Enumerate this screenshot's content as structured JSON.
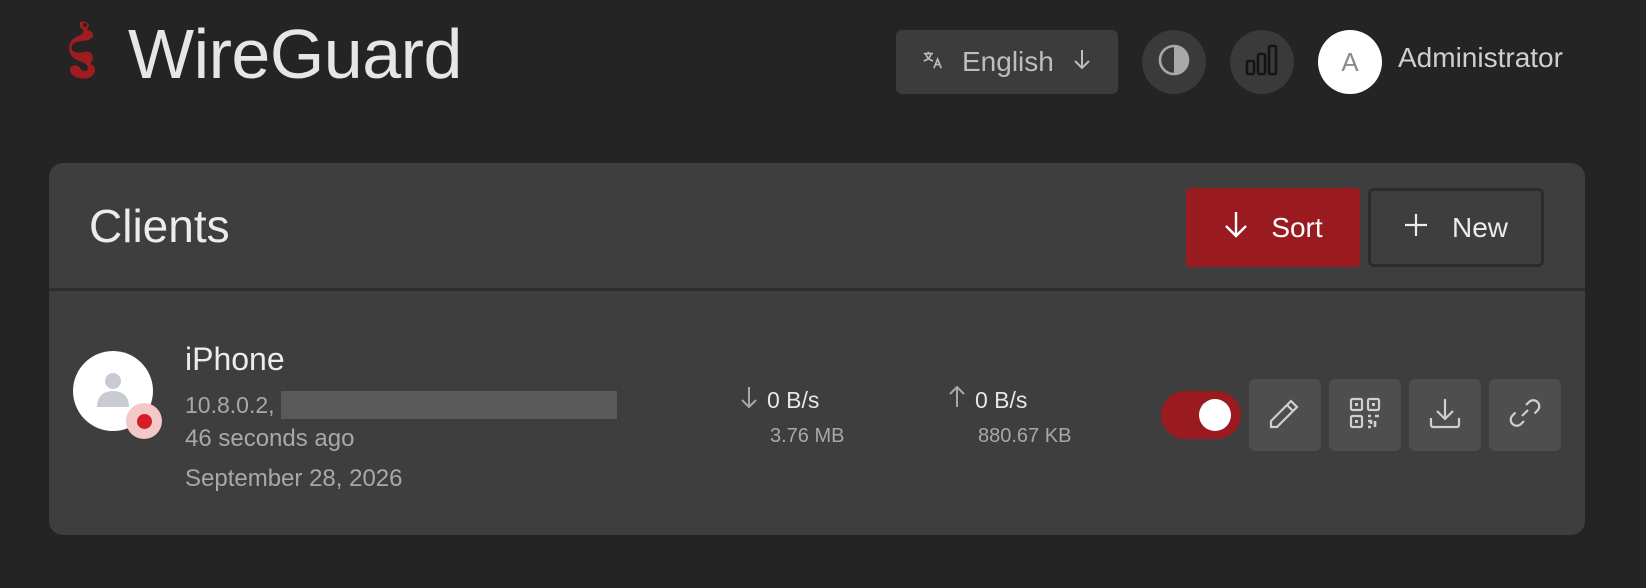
{
  "header": {
    "brand": "WireGuard",
    "language_label": "English",
    "user_initial": "A",
    "user_name": "Administrator"
  },
  "clients_panel": {
    "title": "Clients",
    "sort_label": "Sort",
    "new_label": "New"
  },
  "clients": [
    {
      "name": "iPhone",
      "address": "10.8.0.2,",
      "last_seen": "46 seconds ago",
      "created": "September 28, 2026",
      "rx_rate": "0 B/s",
      "rx_total": "3.76 MB",
      "tx_rate": "0 B/s",
      "tx_total": "880.67 KB",
      "enabled": true
    }
  ],
  "icons": {
    "logo": "wireguard-dragon-icon",
    "language": "translate-icon",
    "language_chevron": "arrow-down-icon",
    "theme": "contrast-icon",
    "stats": "bar-chart-icon",
    "sort": "arrow-down-icon",
    "new": "plus-icon",
    "client_avatar": "user-icon",
    "rx": "arrow-down-icon",
    "tx": "arrow-up-icon",
    "edit": "pencil-icon",
    "qr": "qr-code-icon",
    "download": "download-icon",
    "link": "link-icon"
  },
  "colors": {
    "background": "#242424",
    "card": "#3e3e3e",
    "accent": "#9a1b1f",
    "status_dot": "#d41d24"
  }
}
